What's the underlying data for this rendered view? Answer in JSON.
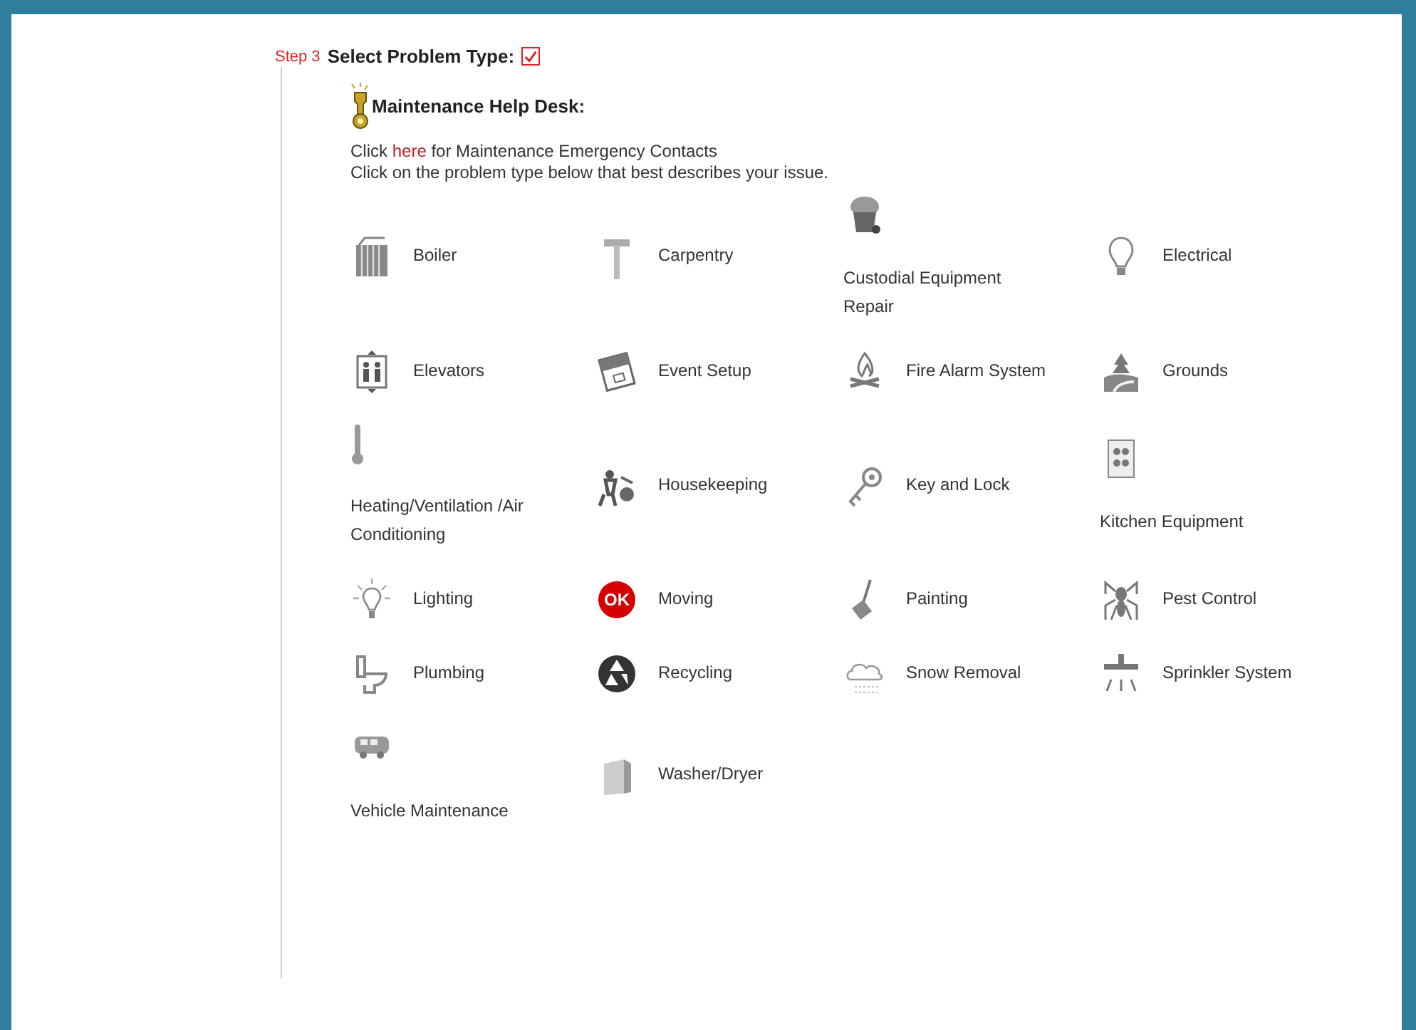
{
  "step": {
    "label": "Step 3",
    "title": "Select Problem Type:",
    "checked": true
  },
  "help_desk": {
    "title": "Maintenance Help Desk:",
    "contact_line": {
      "before": "Click",
      "link": "here",
      "after": "for Maintenance Emergency Contacts"
    },
    "instruction": "Click on the problem type below that best describes your issue."
  },
  "problem_types": [
    {
      "label": "Boiler",
      "kind": "inline"
    },
    {
      "label": "Carpentry",
      "kind": "inline"
    },
    {
      "label": "Custodial Equipment Repair",
      "kind": "stacked"
    },
    {
      "label": "Electrical",
      "kind": "inline"
    },
    {
      "label": "Elevators",
      "kind": "inline"
    },
    {
      "label": "Event Setup",
      "kind": "inline"
    },
    {
      "label": "Fire Alarm System",
      "kind": "inline"
    },
    {
      "label": "Grounds",
      "kind": "inline"
    },
    {
      "label": "Heating/Ventilation /Air Conditioning",
      "kind": "stacked"
    },
    {
      "label": "Housekeeping",
      "kind": "inline"
    },
    {
      "label": "Key and Lock",
      "kind": "inline"
    },
    {
      "label": "Kitchen Equipment",
      "kind": "stacked"
    },
    {
      "label": "Lighting",
      "kind": "inline"
    },
    {
      "label": "Moving",
      "kind": "inline",
      "icon_text": "OK"
    },
    {
      "label": "Painting",
      "kind": "inline"
    },
    {
      "label": "Pest Control",
      "kind": "inline"
    },
    {
      "label": "Plumbing",
      "kind": "inline"
    },
    {
      "label": "Recycling",
      "kind": "inline"
    },
    {
      "label": "Snow Removal",
      "kind": "inline"
    },
    {
      "label": "Sprinkler System",
      "kind": "inline"
    },
    {
      "label": "Vehicle Maintenance",
      "kind": "stacked"
    },
    {
      "label": "Washer/Dryer",
      "kind": "inline"
    }
  ]
}
